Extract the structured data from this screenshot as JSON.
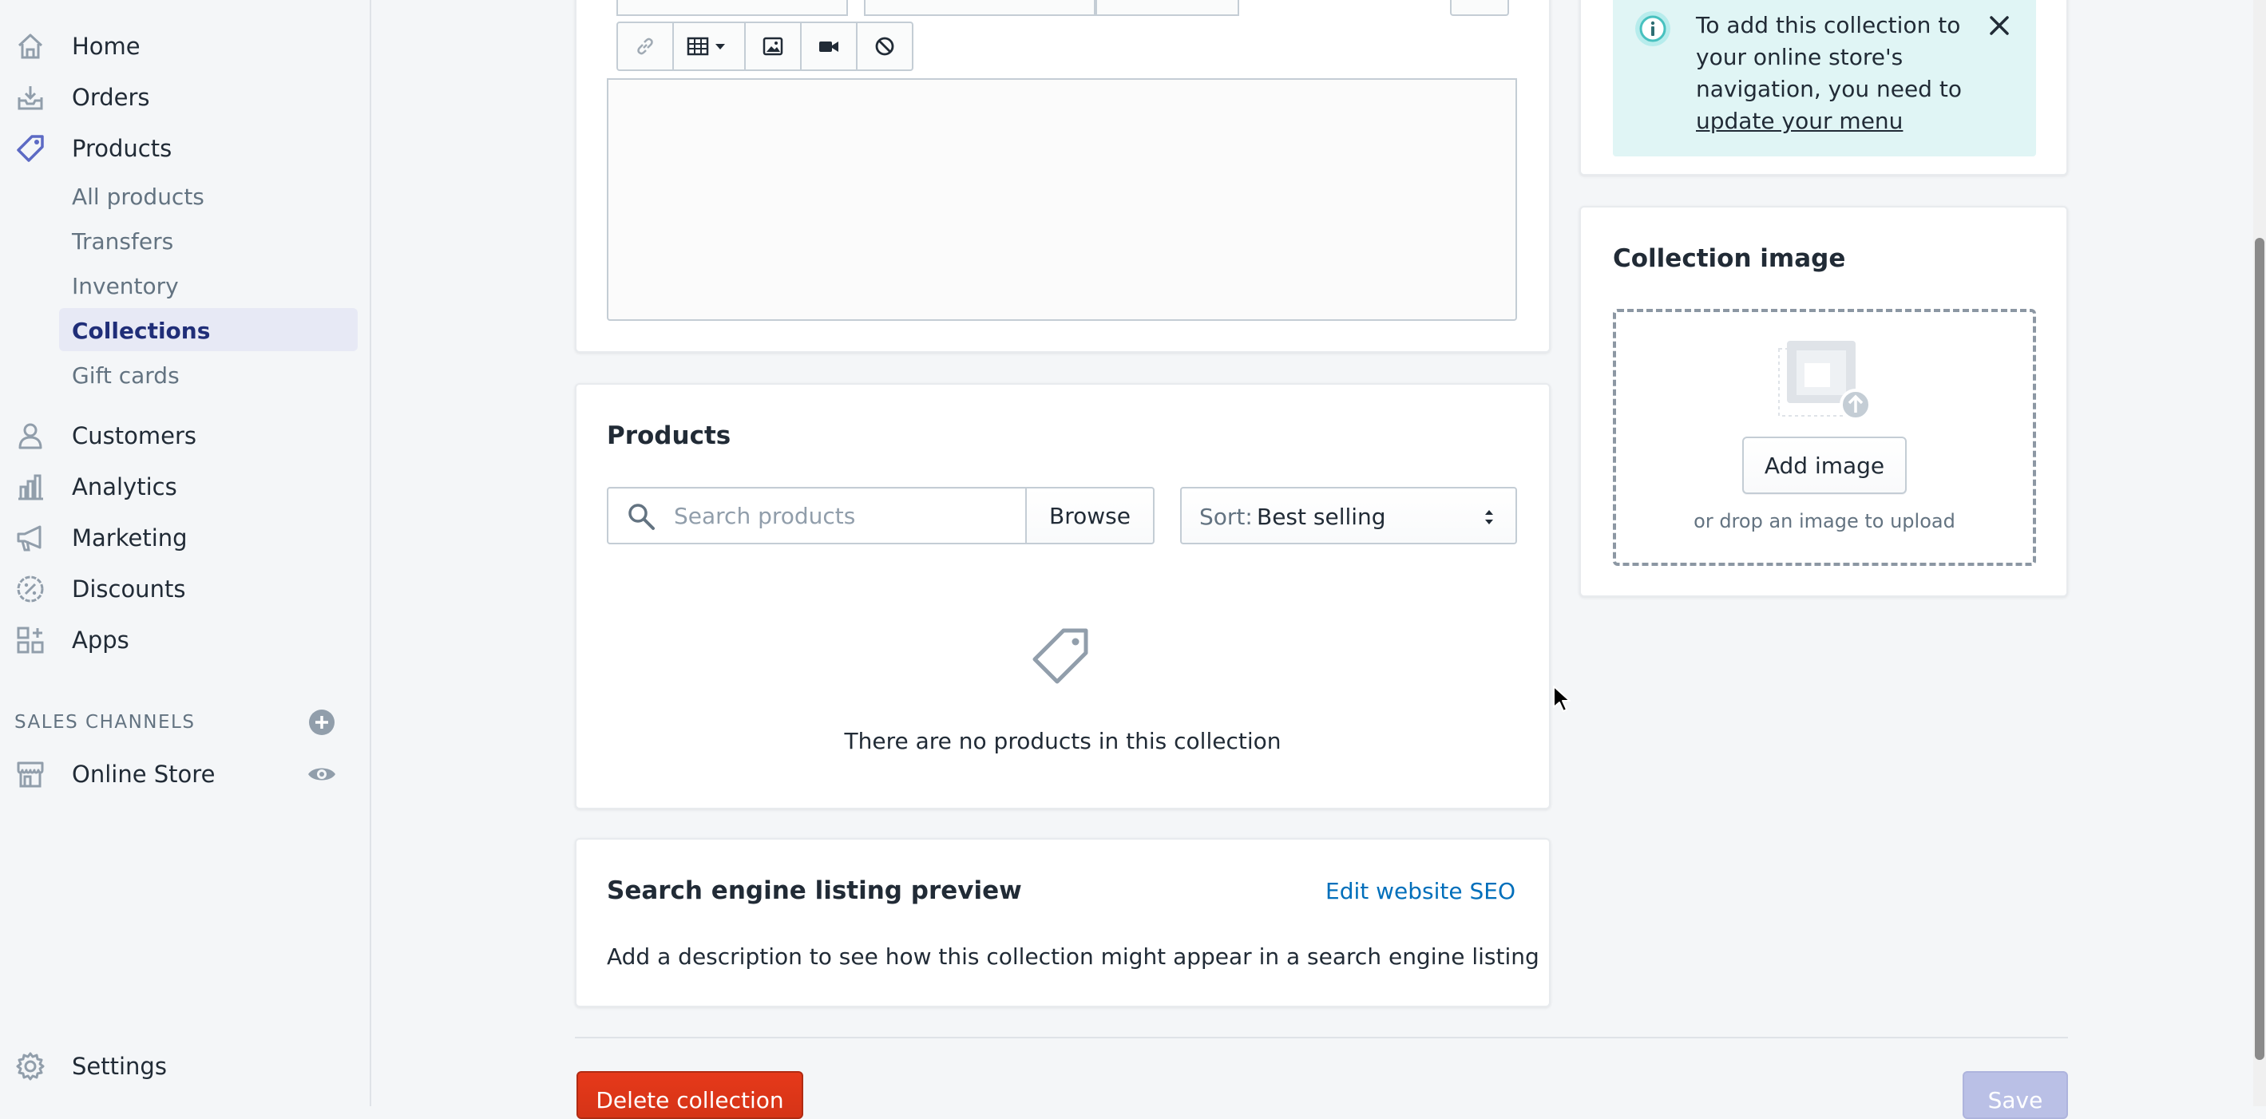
{
  "nav": {
    "home": "Home",
    "orders": "Orders",
    "products": "Products",
    "products_sub": [
      "All products",
      "Transfers",
      "Inventory",
      "Collections",
      "Gift cards"
    ],
    "customers": "Customers",
    "analytics": "Analytics",
    "marketing": "Marketing",
    "discounts": "Discounts",
    "apps": "Apps",
    "sales_channels_heading": "SALES CHANNELS",
    "online_store": "Online Store",
    "settings": "Settings",
    "active_sub_item": "Collections"
  },
  "editor": {
    "toolbar_icons": [
      "link-icon",
      "table-icon",
      "image-icon",
      "video-icon",
      "clear-formatting-icon"
    ]
  },
  "products_card": {
    "title": "Products",
    "search_placeholder": "Search products",
    "browse_label": "Browse",
    "sort_label": "Sort:",
    "sort_value": "Best selling",
    "empty_message": "There are no products in this collection"
  },
  "seo_card": {
    "title": "Search engine listing preview",
    "edit_link": "Edit website SEO",
    "description": "Add a description to see how this collection might appear in a search engine listing"
  },
  "info_banner": {
    "text_line1": "To add this collection to",
    "text_line2": "your online store's",
    "text_line3": "navigation, you need to",
    "link_text": "update your menu"
  },
  "collection_image": {
    "title": "Collection image",
    "add_button": "Add image",
    "hint": "or drop an image to upload"
  },
  "footer": {
    "delete_label": "Delete collection",
    "save_label": "Save"
  },
  "colors": {
    "accent": "#5c6ac4",
    "link": "#006fbb",
    "danger": "#de3618",
    "banner_bg": "#e0f5f5",
    "banner_icon": "#47c1bf"
  }
}
